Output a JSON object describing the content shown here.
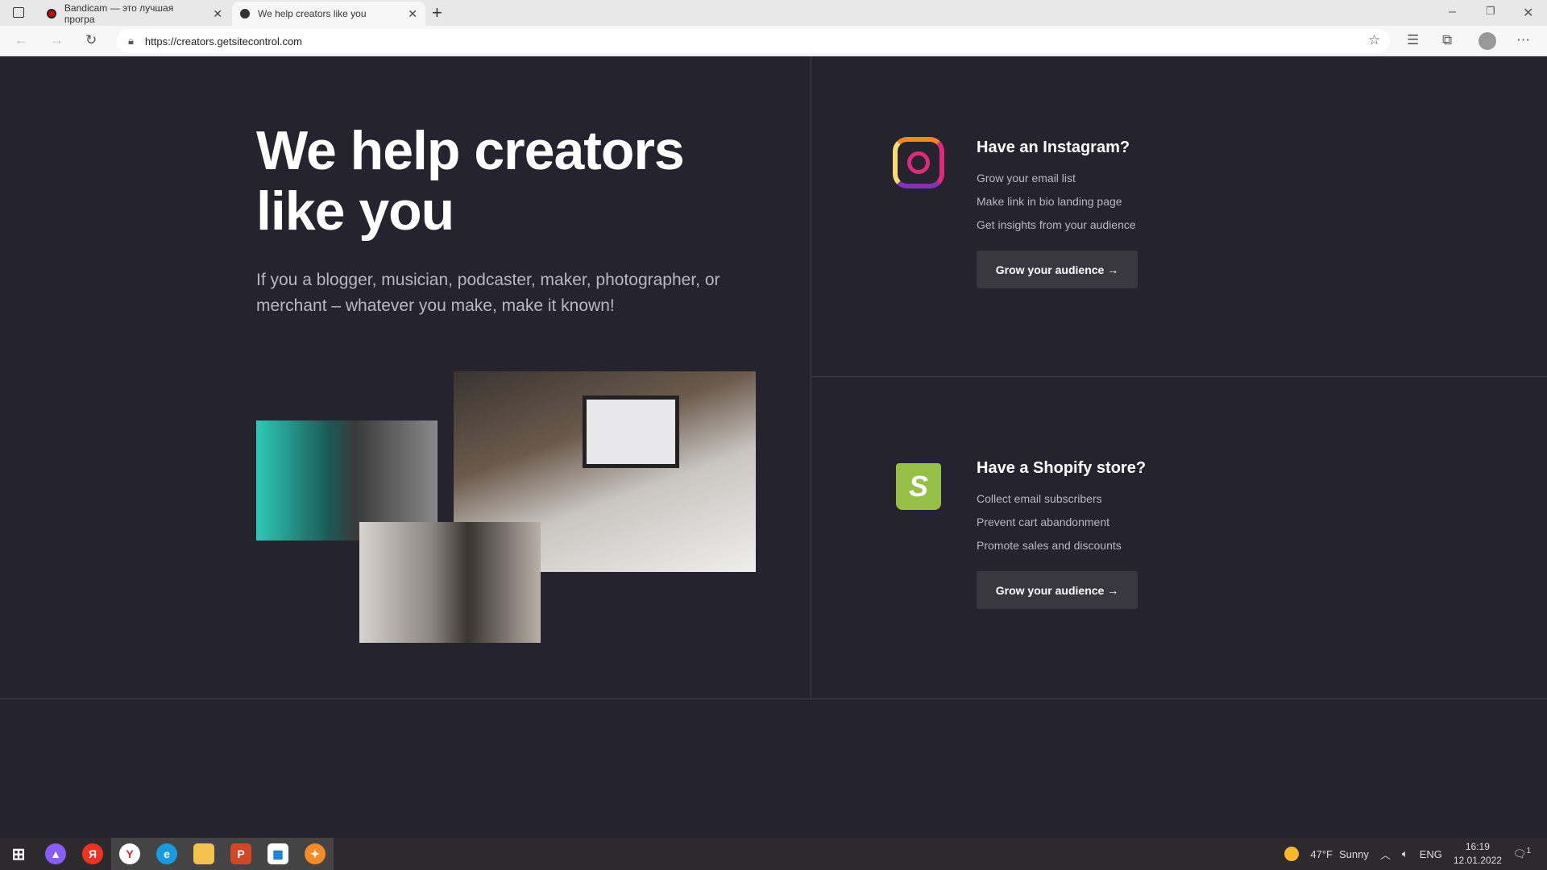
{
  "browser": {
    "tabs": [
      {
        "title": "Bandicam — это лучшая програ"
      },
      {
        "title": "We help creators like you"
      }
    ],
    "url": "https://creators.getsitecontrol.com"
  },
  "hero": {
    "title": "We help creators like you",
    "subtitle": "If you a blogger, musician, podcaster, maker, photographer, or merchant – whatever you make, make it known!"
  },
  "cards": [
    {
      "title": "Have an Instagram?",
      "icon": "instagram-icon",
      "items": [
        "Grow your email list",
        "Make link in bio landing page",
        "Get insights from your audience"
      ],
      "button": "Grow your audience →"
    },
    {
      "title": "Have a Shopify store?",
      "icon": "shopify-icon",
      "items": [
        "Collect email subscribers",
        "Prevent cart abandonment",
        "Promote sales and discounts"
      ],
      "button": "Grow your audience →"
    }
  ],
  "taskbar": {
    "weather_temp": "47°F",
    "weather_text": "Sunny",
    "lang": "ENG",
    "time": "16:19",
    "date": "12.01.2022",
    "notifications": "1"
  }
}
